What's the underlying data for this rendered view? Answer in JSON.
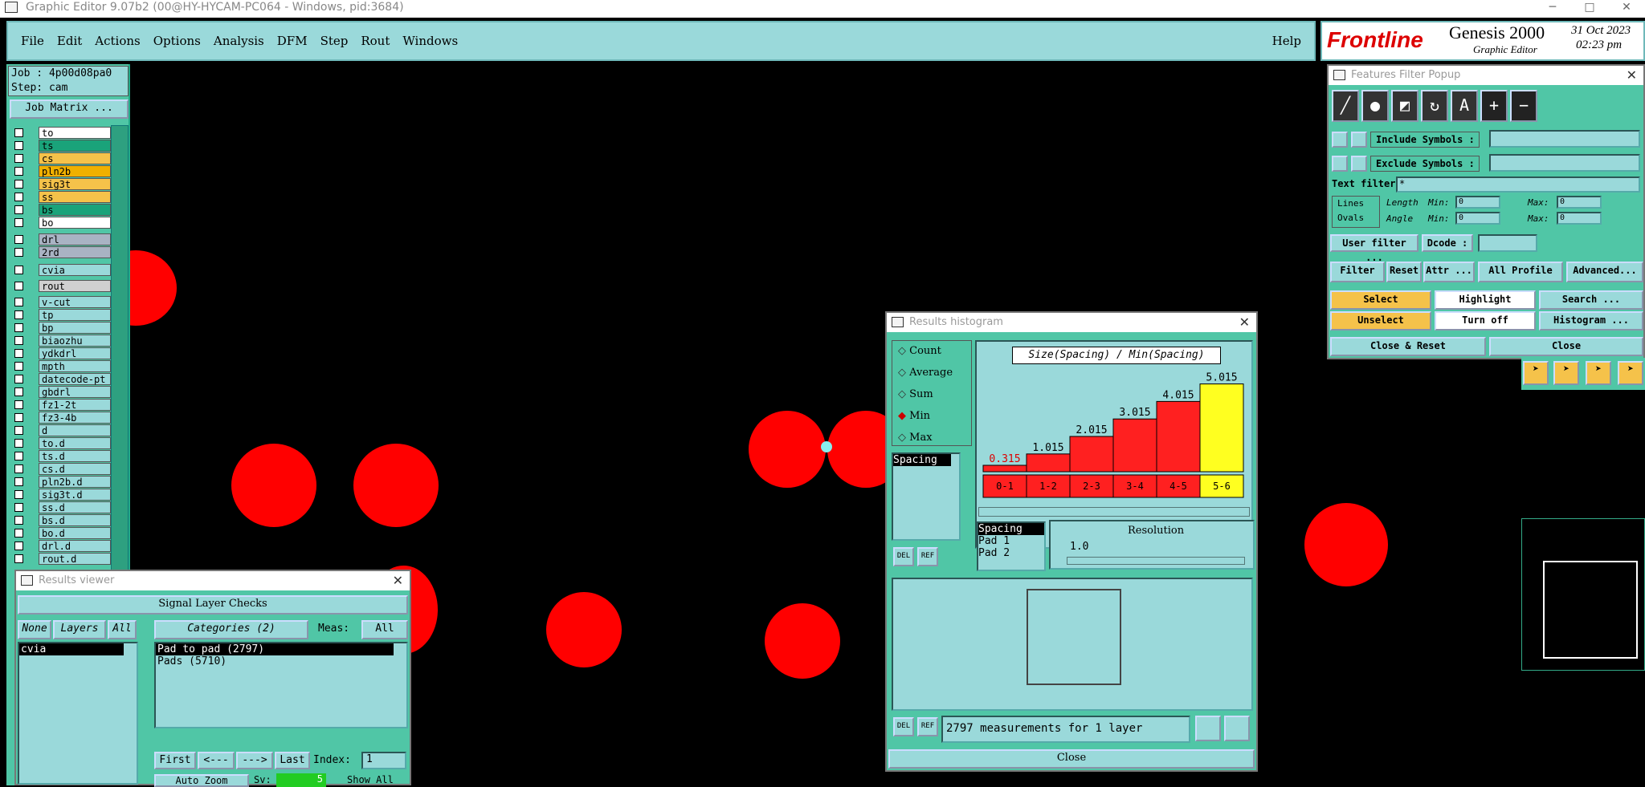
{
  "window": {
    "title": "Graphic Editor 9.07b2 (00@HY-HYCAM-PC064 - Windows, pid:3684)"
  },
  "menu": [
    "File",
    "Edit",
    "Actions",
    "Options",
    "Analysis",
    "DFM",
    "Step",
    "Rout",
    "Windows"
  ],
  "menu_help": "Help",
  "logo": {
    "brand": "Frontline",
    "product": "Genesis 2000",
    "subtitle": "Graphic Editor",
    "date": "31 Oct 2023",
    "time": "02:23 pm"
  },
  "job": {
    "job": "Job : 4p00d08pa0",
    "step": "Step: cam",
    "matrix": "Job Matrix ..."
  },
  "layers": [
    {
      "name": "to",
      "color": "#ffffff"
    },
    {
      "name": "ts",
      "color": "#1aa37a"
    },
    {
      "name": "cs",
      "color": "#f5c24a"
    },
    {
      "name": "pln2b",
      "color": "#f0b000"
    },
    {
      "name": "sig3t",
      "color": "#f5c24a"
    },
    {
      "name": "ss",
      "color": "#f5c24a"
    },
    {
      "name": "bs",
      "color": "#1aa37a"
    },
    {
      "name": "bo",
      "color": "#ffffff"
    },
    {
      "name": "drl",
      "color": "#a9b3c3"
    },
    {
      "name": "2rd",
      "color": "#a9b3c3"
    },
    {
      "name": "cvia",
      "color": "#9ad9da"
    },
    {
      "name": "rout",
      "color": "#d0d0d0"
    },
    {
      "name": "v-cut",
      "color": "#9ad9da"
    },
    {
      "name": "tp",
      "color": "#9ad9da"
    },
    {
      "name": "bp",
      "color": "#9ad9da"
    },
    {
      "name": "biaozhu",
      "color": "#9ad9da"
    },
    {
      "name": "ydkdrl",
      "color": "#9ad9da"
    },
    {
      "name": "mpth",
      "color": "#9ad9da"
    },
    {
      "name": "datecode-pt",
      "color": "#9ad9da"
    },
    {
      "name": "gbdrl",
      "color": "#9ad9da"
    },
    {
      "name": "fz1-2t",
      "color": "#9ad9da"
    },
    {
      "name": "fz3-4b",
      "color": "#9ad9da"
    },
    {
      "name": "d",
      "color": "#9ad9da"
    },
    {
      "name": "to.d",
      "color": "#9ad9da"
    },
    {
      "name": "ts.d",
      "color": "#9ad9da"
    },
    {
      "name": "cs.d",
      "color": "#9ad9da"
    },
    {
      "name": "pln2b.d",
      "color": "#9ad9da"
    },
    {
      "name": "sig3t.d",
      "color": "#9ad9da"
    },
    {
      "name": "ss.d",
      "color": "#9ad9da"
    },
    {
      "name": "bs.d",
      "color": "#9ad9da"
    },
    {
      "name": "bo.d",
      "color": "#9ad9da"
    },
    {
      "name": "drl.d",
      "color": "#9ad9da"
    },
    {
      "name": "rout.d",
      "color": "#9ad9da"
    }
  ],
  "results_viewer": {
    "title": "Results viewer",
    "header": "Signal Layer Checks",
    "none": "None",
    "layers": "Layers",
    "all": "All",
    "categories": "Categories (2)",
    "meas_label": "Meas:",
    "meas_value": "All",
    "layer_item": "cvia",
    "items": [
      "Pad to pad (2797)",
      "Pads (5710)"
    ],
    "first": "First",
    "prev": "<---",
    "next": "--->",
    "last": "Last",
    "index_label": "Index:",
    "index_value": "1",
    "auto_zoom": "Auto Zoom",
    "sv_label": "Sv:",
    "sv_value": "5",
    "show_all": "Show All"
  },
  "histogram": {
    "title": "Results histogram",
    "options": [
      "Count",
      "Average",
      "Sum",
      "Min",
      "Max"
    ],
    "selected": "Min",
    "list_item": "Spacing",
    "chart_title": "Size(Spacing) / Min(Spacing)",
    "res_label": "Resolution",
    "res_value": "1.0",
    "attrs": [
      "Spacing",
      "Pad 1",
      "Pad 2"
    ],
    "del": "DEL",
    "ref": "REF",
    "status": "2797 measurements for 1 layer",
    "close": "Close"
  },
  "chart_data": {
    "type": "bar",
    "title": "Size(Spacing) / Min(Spacing)",
    "categories": [
      "0-1",
      "1-2",
      "2-3",
      "3-4",
      "4-5",
      "5-6"
    ],
    "values": [
      0.315,
      1.015,
      2.015,
      3.015,
      4.015,
      5.015
    ],
    "labels": [
      "0.315",
      "1.015",
      "2.015",
      "3.015",
      "4.015",
      "5.015"
    ],
    "colors": {
      "bar": "#ff2020",
      "selected": "#ffff20"
    },
    "ylim": [
      0,
      5.5
    ]
  },
  "filter": {
    "title": "Features Filter Popup",
    "include": "Include Symbols :",
    "exclude": "Exclude Symbols :",
    "text_filter": "Text filter",
    "text_value": "*",
    "lines": "Lines",
    "ovals": "Ovals",
    "length": "Length",
    "angle": "Angle",
    "min": "Min:",
    "max": "Max:",
    "zero": "0",
    "user_filter": "User filter ...",
    "dcode": "Dcode :",
    "filter": "Filter",
    "reset": "Reset",
    "attr": "Attr ...",
    "all_profile": "All Profile",
    "advanced": "Advanced...",
    "select": "Select",
    "highlight": "Highlight",
    "search": "Search ...",
    "unselect": "Unselect",
    "turn_off": "Turn off",
    "histogram": "Histogram ...",
    "close_reset": "Close & Reset",
    "close": "Close"
  }
}
